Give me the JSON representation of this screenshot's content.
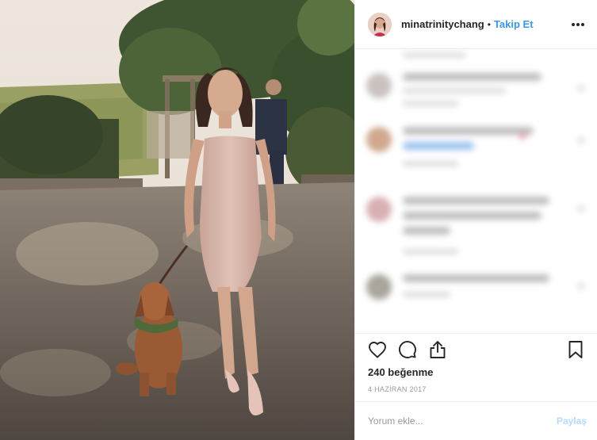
{
  "post": {
    "photo": {
      "alt": ""
    },
    "author": {
      "username": "minatrinitychang",
      "separator": "•",
      "follow_label": "Takip Et"
    },
    "likes": "240 beğenme",
    "date": "4 HAZİRAN 2017",
    "comment_box": {
      "placeholder": "Yorum ekle...",
      "submit_label": "Paylaş"
    },
    "icons": {
      "like": "heart-icon",
      "comment": "comment-icon",
      "share": "share-icon",
      "save": "bookmark-icon",
      "more": "more-options-icon"
    }
  },
  "colors": {
    "link": "#3897f0",
    "text": "#262626",
    "muted": "#999999",
    "border": "#efefef",
    "share_disabled": "#b3dbff"
  }
}
